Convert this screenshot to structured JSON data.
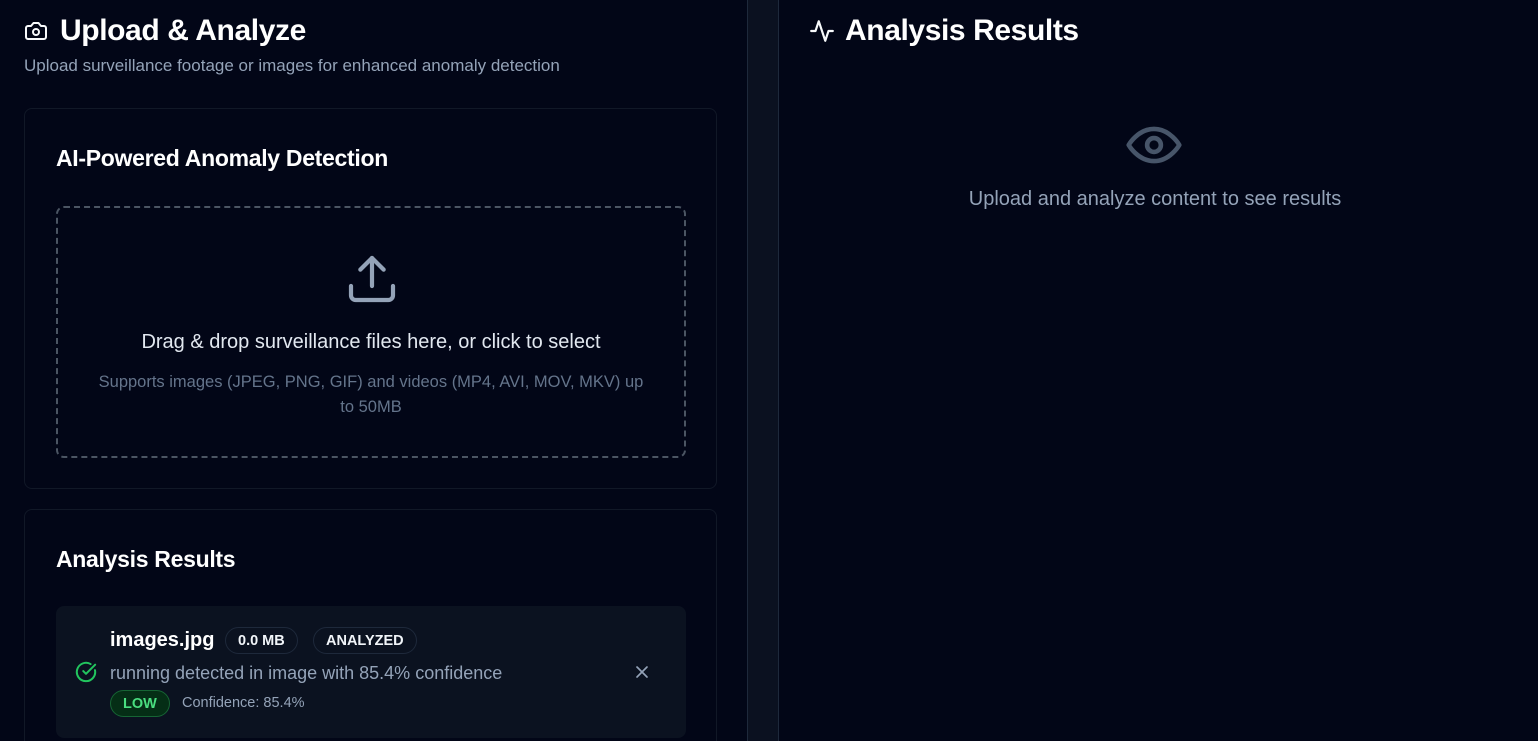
{
  "left": {
    "title": "Upload & Analyze",
    "subtitle": "Upload surveillance footage or images for enhanced anomaly detection",
    "header_icon": "camera-icon",
    "upload_card": {
      "title": "AI-Powered Anomaly Detection",
      "dropzone_icon": "upload-icon",
      "dropzone_text": "Drag & drop surveillance files here, or click to select",
      "dropzone_hint": "Supports images (JPEG, PNG, GIF) and videos (MP4, AVI, MOV, MKV) up to 50MB"
    },
    "results_card": {
      "title": "Analysis Results",
      "items": [
        {
          "status_icon": "check-circle-icon",
          "file_name": "images.jpg",
          "file_size": "0.0 MB",
          "status": "ANALYZED",
          "message": "running detected in image with 85.4% confidence",
          "severity": "LOW",
          "confidence_text": "Confidence: 85.4%",
          "remove_icon": "close-icon"
        }
      ]
    }
  },
  "right": {
    "title": "Analysis Results",
    "header_icon": "activity-icon",
    "empty_icon": "eye-icon",
    "empty_message": "Upload and analyze content to see results"
  },
  "colors": {
    "background": "#020617",
    "success": "#22c55e",
    "muted_text": "#94a3b8"
  }
}
